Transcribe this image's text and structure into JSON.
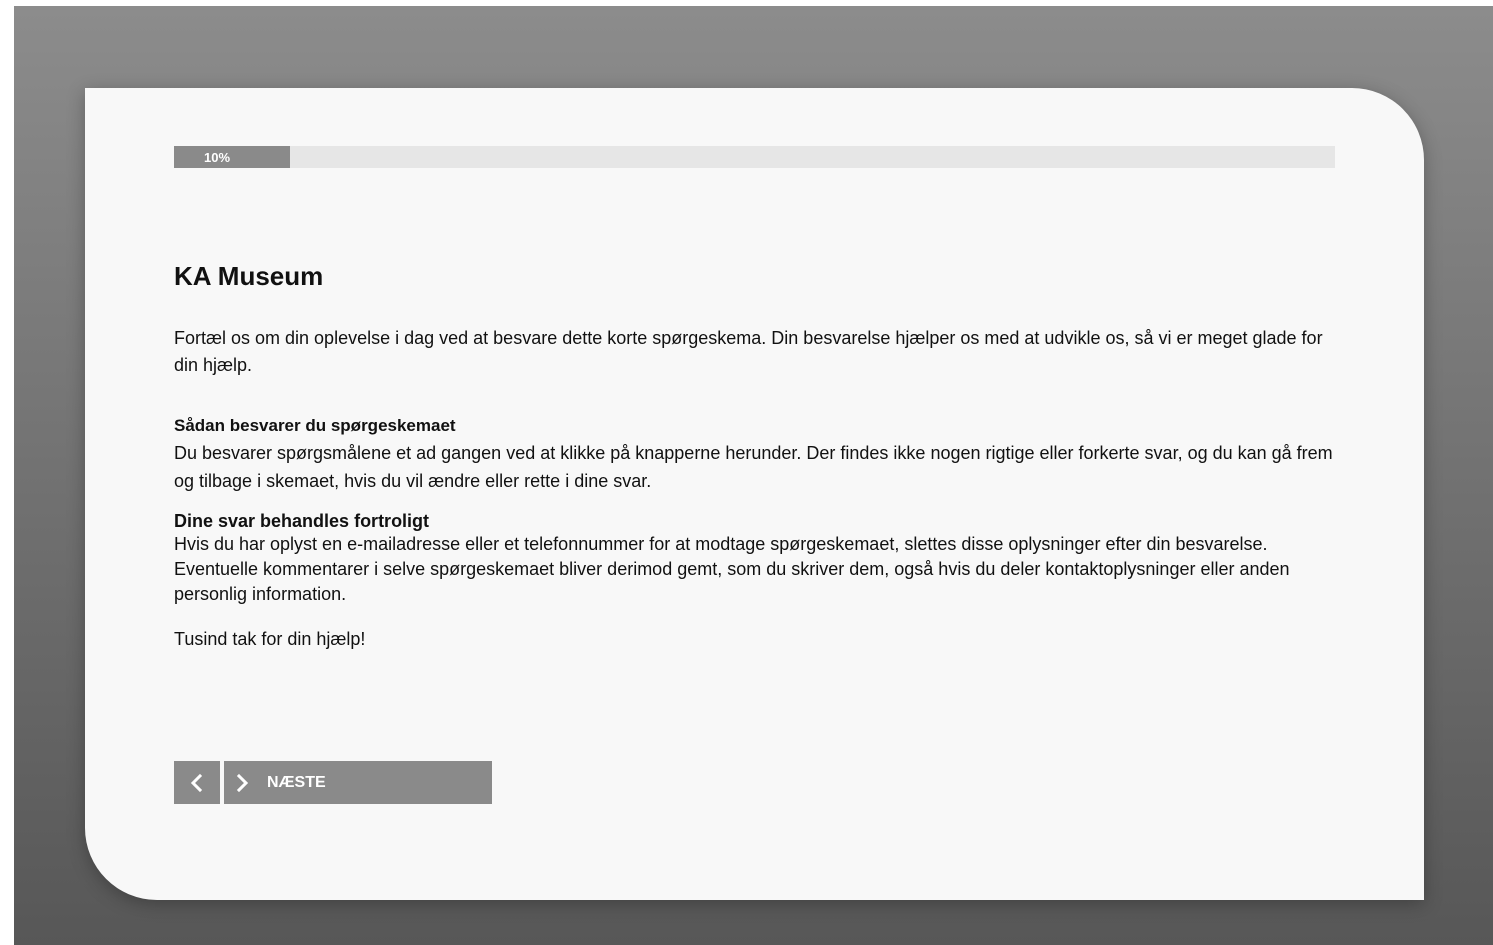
{
  "survey": {
    "progress": {
      "percent": 10,
      "label": "10%"
    },
    "title": "KA Museum",
    "intro": "Fortæl os om din oplevelse i dag ved at besvare dette korte spørgeskema. Din besvarelse hjælper os med at udvikle os, så vi er meget glade for din hjælp.",
    "section1": {
      "heading": "Sådan besvarer du spørgeskemaet",
      "text": "Du besvarer spørgsmålene et ad gangen ved at klikke på knapperne herunder. Der findes ikke nogen rigtige eller forkerte svar, og du kan gå frem og tilbage i skemaet, hvis du vil ændre eller rette i dine svar."
    },
    "section2": {
      "heading": "Dine svar behandles fortroligt",
      "text": "Hvis du har oplyst en e-mailadresse eller et telefonnummer for at modtage spørgeskemaet, slettes disse oplysninger efter din besvarelse. Eventuelle kommentarer i selve spørgeskemaet bliver derimod gemt, som du skriver dem, også hvis du deler kontaktoplysninger eller anden personlig information."
    },
    "thanks": "Tusind tak for din hjælp!"
  },
  "navigation": {
    "prev_icon": "chevron-left-icon",
    "next_icon": "chevron-right-icon",
    "next_label": "NÆSTE"
  },
  "colors": {
    "button": "#8a8a8a",
    "progress_fill": "#8a8a8a",
    "progress_track": "#e6e6e6",
    "card": "#f8f8f8"
  }
}
